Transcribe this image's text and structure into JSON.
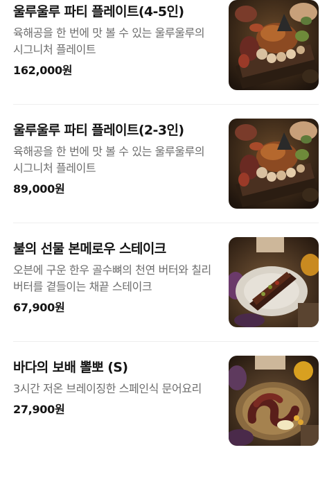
{
  "menu": {
    "items": [
      {
        "name": "울루울루 파티 플레이트(4-5인)",
        "description": "육해공을 한 번에 맛 볼 수 있는 울루울루의 시그니처 플레이트",
        "price": "162,000원",
        "image": "platter-photo"
      },
      {
        "name": "울루울루 파티 플레이트(2-3인)",
        "description": "육해공을 한 번에 맛 볼 수 있는 울루울루의 시그니처 플레이트",
        "price": "89,000원",
        "image": "platter-photo"
      },
      {
        "name": "불의 선물 본메로우 스테이크",
        "description": "오븐에 구운 한우 골수뼈의 천연 버터와 칠리 버터를 곁들이는 채끝 스테이크",
        "price": "67,900원",
        "image": "steak-photo"
      },
      {
        "name": "바다의 보배 뽈뽀 (S)",
        "description": "3시간 저온 브레이징한 스페인식 문어요리",
        "price": "27,900원",
        "image": "octopus-photo"
      }
    ]
  },
  "colors": {
    "title": "#141414",
    "description": "#6d6d6d",
    "divider": "#eeeeee"
  }
}
